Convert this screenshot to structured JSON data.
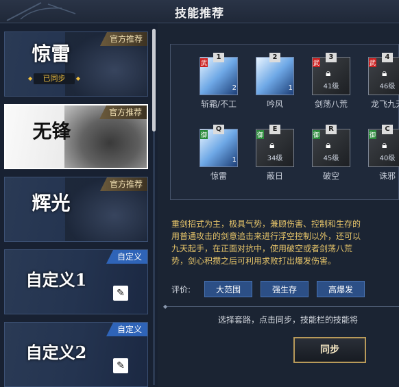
{
  "header": {
    "title": "技能推荐"
  },
  "cards": [
    {
      "name": "惊雷",
      "badge": "官方推荐",
      "status": "已同步"
    },
    {
      "name": "无锋",
      "badge": "官方推荐"
    },
    {
      "name": "辉光",
      "badge": "官方推荐"
    },
    {
      "name": "自定义1",
      "badge": "自定义"
    },
    {
      "name": "自定义2",
      "badge": "自定义"
    }
  ],
  "skills_row1": [
    {
      "key": "1",
      "tag": "武",
      "label": "斩霜/不工",
      "count": "2"
    },
    {
      "key": "2",
      "tag": "",
      "label": "吟风",
      "count": "1"
    },
    {
      "key": "3",
      "tag": "武",
      "label": "剑荡八荒",
      "level": "41级"
    },
    {
      "key": "4",
      "tag": "武",
      "label": "龙飞九天",
      "level": "46级"
    }
  ],
  "skills_row2": [
    {
      "key": "Q",
      "tag": "御",
      "label": "惊雷",
      "count": "1"
    },
    {
      "key": "E",
      "tag": "御",
      "label": "蔽日",
      "level": "34级"
    },
    {
      "key": "R",
      "tag": "御",
      "label": "破空",
      "level": "45级"
    },
    {
      "key": "C",
      "tag": "御",
      "label": "诛邪",
      "level": "40级"
    }
  ],
  "description": "重剑招式为主，极具气势，兼顾伤害、控制和生存的\n用普通攻击的剑意追击来进行浮空控制以外，还可以\n九天起手，在正面对抗中，使用破空或者剑荡八荒\n势，剑心积攒之后可利用求败打出爆发伤害。",
  "rating": {
    "label": "评价:",
    "tags": [
      "大范围",
      "强生存",
      "高爆发"
    ]
  },
  "hint": "选择套路，点击同步，技能栏的技能将",
  "sync_button": "同步",
  "icons": {
    "edit": "pencil-icon",
    "lock": "lock-icon"
  }
}
